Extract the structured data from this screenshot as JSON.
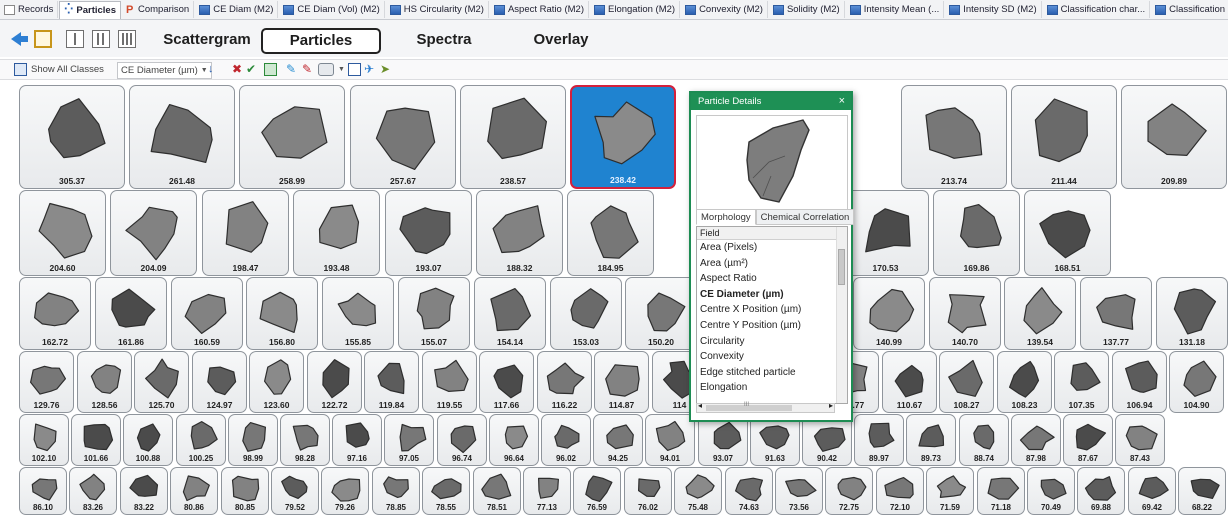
{
  "tabs": [
    {
      "label": "Records",
      "icon": "records-icon"
    },
    {
      "label": "Particles",
      "icon": "particles-icon",
      "active": true
    },
    {
      "label": "Comparison",
      "icon": "comparison-icon"
    },
    {
      "label": "CE Diam (M2)",
      "icon": "chart-icon"
    },
    {
      "label": "CE Diam (Vol) (M2)",
      "icon": "chart-icon"
    },
    {
      "label": "HS Circularity (M2)",
      "icon": "chart-icon"
    },
    {
      "label": "Aspect Ratio (M2)",
      "icon": "chart-icon"
    },
    {
      "label": "Elongation (M2)",
      "icon": "chart-icon"
    },
    {
      "label": "Convexity (M2)",
      "icon": "chart-icon"
    },
    {
      "label": "Solidity (M2)",
      "icon": "chart-icon"
    },
    {
      "label": "Intensity Mean (...",
      "icon": "chart-icon"
    },
    {
      "label": "Intensity SD (M2)",
      "icon": "chart-icon"
    },
    {
      "label": "Classification char...",
      "icon": "chart-icon"
    },
    {
      "label": "Classification char...",
      "icon": "chart-icon"
    },
    {
      "label": "Scattergram",
      "icon": "chart-icon"
    }
  ],
  "views": {
    "scattergram": "Scattergram",
    "particles": "Particles",
    "spectra": "Spectra",
    "overlay": "Overlay",
    "selected": "Particles"
  },
  "toolbar": {
    "show_all_classes": "Show All Classes",
    "sort_field": "CE Diameter (µm)"
  },
  "colors": {
    "selected_card": "#1f83d0",
    "selected_border": "#d4213c",
    "popup_title": "#1e9055",
    "accent_arrow": "#2e7fd3"
  },
  "gallery": {
    "rows": [
      [
        "305.37",
        "261.48",
        "258.99",
        "257.67",
        "238.57",
        "238.42",
        "",
        "",
        "213.74",
        "211.44",
        "209.89"
      ],
      [
        "204.60",
        "204.09",
        "198.47",
        "193.48",
        "193.07",
        "188.32",
        "184.95",
        "",
        "172.10",
        "170.53",
        "169.86",
        "168.51"
      ],
      [
        "162.72",
        "161.86",
        "160.59",
        "156.80",
        "155.85",
        "155.07",
        "154.14",
        "153.03",
        "150.20",
        "",
        "",
        "140.99",
        "140.70",
        "139.54",
        "137.77",
        "131.18"
      ],
      [
        "129.76",
        "128.56",
        "125.70",
        "124.97",
        "123.60",
        "122.72",
        "119.84",
        "119.55",
        "117.66",
        "116.22",
        "114.87",
        "114",
        "",
        "",
        "112.77",
        "110.67",
        "108.27",
        "108.23",
        "107.35",
        "106.94",
        "104.90"
      ],
      [
        "102.10",
        "101.66",
        "100.88",
        "100.25",
        "98.99",
        "98.28",
        "97.16",
        "97.05",
        "96.74",
        "96.64",
        "96.02",
        "94.25",
        "94.01",
        "93.07",
        "91.63",
        "90.42",
        "89.97",
        "89.73",
        "88.74",
        "87.98",
        "87.67",
        "87.43"
      ],
      [
        "86.10",
        "83.26",
        "83.22",
        "80.86",
        "80.85",
        "79.52",
        "79.26",
        "78.85",
        "78.55",
        "78.51",
        "77.13",
        "76.59",
        "76.02",
        "75.48",
        "74.63",
        "73.56",
        "72.75",
        "72.10",
        "71.59",
        "71.18",
        "70.49",
        "69.88",
        "69.42",
        "68.22"
      ]
    ]
  },
  "popup": {
    "title": "Particle Details",
    "close": "×",
    "tabs": [
      "Morphology",
      "Chemical Correlation"
    ],
    "list_header": "Field",
    "fields": [
      "Area (Pixels)",
      "Area (µm²)",
      "Aspect Ratio",
      "CE Diameter (µm)",
      "Centre X Position (µm)",
      "Centre Y Position (µm)",
      "Circularity",
      "Convexity",
      "Edge stitched particle",
      "Elongation"
    ],
    "bold_field": "CE Diameter (µm)",
    "scroll_left": "◂",
    "scroll_right": "▸",
    "scroll_grip": "III"
  }
}
